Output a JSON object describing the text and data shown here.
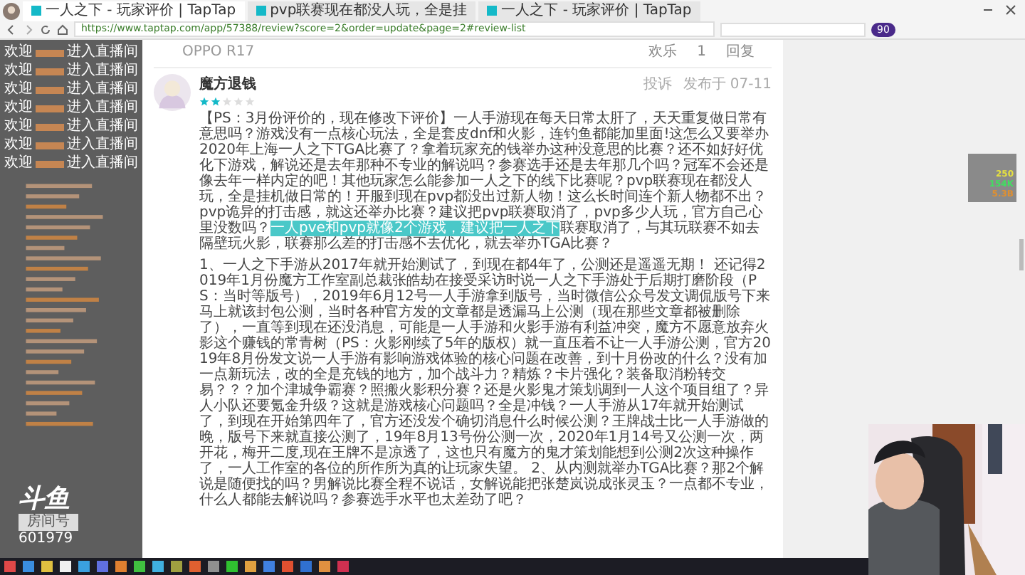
{
  "browser": {
    "tabs": [
      {
        "title": "一人之下 - 玩家评价 | TapTap",
        "selected": true
      },
      {
        "title": "pvp联赛现在都没人玩，全是挂",
        "selected": false
      },
      {
        "title": "一人之下 - 玩家评价 | TapTap",
        "selected": false
      }
    ],
    "url": "https://www.taptap.com/app/57388/review?score=2&order=update&page=2#review-list",
    "badge": "90"
  },
  "chat": {
    "welcome_lines": [
      {
        "prefix": "欢迎",
        "suffix": "进入直播间"
      },
      {
        "prefix": "欢迎",
        "suffix": "进入直播间"
      },
      {
        "prefix": "欢迎",
        "suffix": "进入直播间"
      },
      {
        "prefix": "欢迎",
        "suffix": "进入直播间"
      },
      {
        "prefix": "欢迎",
        "suffix": "进入直播间"
      },
      {
        "prefix": "欢迎",
        "suffix": "进入直播间"
      },
      {
        "prefix": "欢迎",
        "suffix": "进入直播间"
      }
    ],
    "logo": {
      "brand": "斗鱼",
      "room_label": "房间号",
      "room_number": "601979"
    }
  },
  "prev_review": {
    "device": "OPPO R17",
    "actions": [
      "欢乐",
      "1",
      "回复"
    ]
  },
  "review": {
    "author": "魔方退钱",
    "stars": 2,
    "report": "投诉",
    "date": "发布于 07-11",
    "paragraphs": [
      [
        {
          "text": "【PS：3月份评价的，现在修改下评价】一人手游现在每天日常太肝了，天天重复做日常有意思吗？游戏没有一点核心玩法，全是套皮dnf和火影，连钓鱼都能加里面!这怎么又要举办2020年上海一人之下TGA比赛了？拿着玩家充的钱举办这种没意思的比赛？还不如好好优化下游戏，解说还是去年那种不专业的解说吗？参赛选手还是去年那几个吗？冠军不会还是像去年一样内定的吧！其他玩家怎么能参加一人之下的线下比赛呢？pvp联赛现在都没人玩，全是挂机做日常的！开服到现在pvp都没出过新人物！这么长时间连个新人物都不出？pvp诡异的打击感，就这还举办比赛？建议把pvp联赛取消了，pvp多少人玩，官方自己心里没数吗？",
          "highlighted": false
        },
        {
          "text": "一人pve和pvp就像2个游戏，建议把一人之下",
          "highlighted": true
        },
        {
          "text": "联赛取消了，与其玩联赛不如去隔壁玩火影，联赛那么差的打击感不去优化，就去举办TGA比赛？",
          "highlighted": false
        }
      ],
      [
        {
          "text": "1、一人之下手游从2017年就开始测试了，到现在都4年了，公测还是遥遥无期！ 还记得2019年1月份魔方工作室副总裁张皓劫在接受采访时说一人之下手游处于后期打磨阶段（PS：当时等版号），2019年6月12号一人手游拿到版号，当时微信公众号发文调侃版号下来马上就该封包公测，当时各种官方发的文章都是透漏马上公测（现在那些文章都被删除了），一直等到现在还没消息，可能是一人手游和火影手游有利益冲突，魔方不愿意放弃火影这个赚钱的常青树（PS：火影刚续了5年的版权）就一直压着不让一人手游公测，官方2019年8月份发文说一人手游有影响游戏体验的核心问题在改善，到十月份改的什么？没有加一点新玩法，改的全是充钱的地方，加个战斗力？精炼？卡片强化？装备取消粉转交易？？？加个津城争霸赛？照搬火影积分赛？还是火影鬼才策划调到一人这个项目组了？异人小队还要氪金升级？这就是游戏核心问题吗？全是冲钱？一人手游从17年就开始测试了，到现在开始第四年了，官方还没发个确切消息什么时候公测？王牌战士比一人手游做的晚，版号下来就直接公测了，19年8月13号份公测一次，2020年1月14号又公测一次，两开花，梅开二度,现在王牌不是凉透了，这也只有魔方的鬼才策划能想到公测2次这种操作了，一人工作室的各位的所作所为真的让玩家失望。 2、从内测就举办TGA比赛？那2个解说是随便找的吗？男解说比赛全程不说话，女解说能把张楚岚说成张灵玉？一点都不专业，什么人都能去解说吗？参赛选手水平也太差劲了吧？",
          "highlighted": false
        }
      ]
    ]
  },
  "stats_widget": [
    {
      "value": "250",
      "color": "#e6e040"
    },
    {
      "value": "154K",
      "color": "#40e060"
    },
    {
      "value": "5.3B",
      "color": "#e09030"
    }
  ],
  "taskbar": [
    {
      "color": "#e04848"
    },
    {
      "color": "#3a8ee0"
    },
    {
      "color": "#e0c040"
    },
    {
      "color": "#f0f0f0"
    },
    {
      "color": "#3aa0e0"
    },
    {
      "color": "#6070e0"
    },
    {
      "color": "#e08030"
    },
    {
      "color": "#40c040"
    },
    {
      "color": "#40b0e0"
    },
    {
      "color": "#a0a040"
    },
    {
      "color": "#e06030"
    },
    {
      "color": "#909090"
    },
    {
      "color": "#30c030"
    },
    {
      "color": "#e0a040"
    },
    {
      "color": "#4080e0"
    },
    {
      "color": "#e05030"
    },
    {
      "color": "#3070d0"
    },
    {
      "color": "#e09040"
    },
    {
      "color": "#d03050"
    }
  ]
}
